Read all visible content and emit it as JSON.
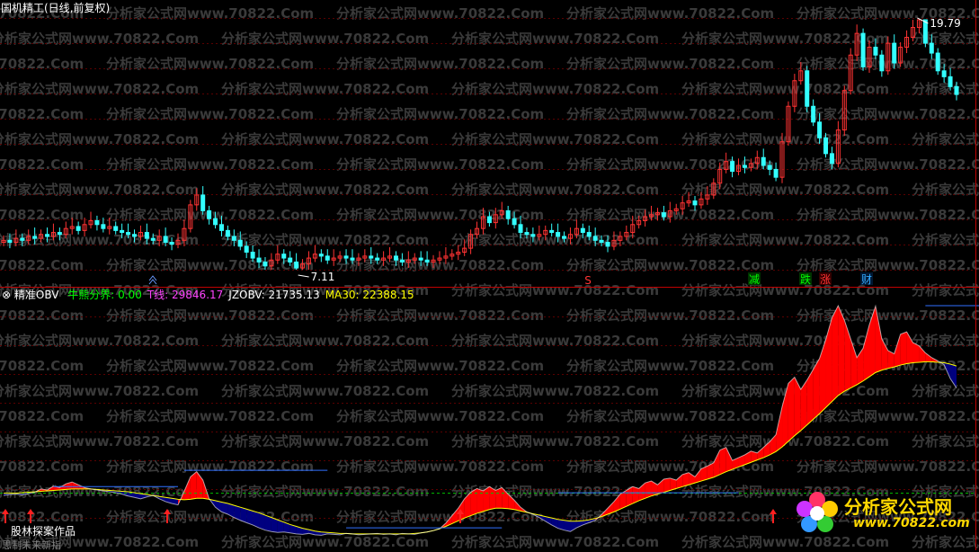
{
  "header": {
    "title": "国机精工(日线,前复权)",
    "indicator_name": "精准OBV",
    "fields": [
      {
        "label": "牛熊分界:",
        "value": "0.00",
        "color": "#00ff00"
      },
      {
        "label": "T线:",
        "value": "29846.17",
        "color": "#ff44ff"
      },
      {
        "label": "JZOBV:",
        "value": "21735.13",
        "color": "#ffffff"
      },
      {
        "label": "MA30:",
        "value": "22388.15",
        "color": "#ffff00"
      }
    ]
  },
  "watermark": {
    "cn": "分析家公式网",
    "url": "www.70822.Com"
  },
  "annotations": {
    "high_label": "19.79",
    "low_label": "7.11",
    "signals": [
      {
        "text": "减",
        "color": "#00ff00",
        "bg": "#003300"
      },
      {
        "text": "跌",
        "color": "#00ff00",
        "bg": "#003300"
      },
      {
        "text": "涨",
        "color": "#ff3333",
        "bg": "#330000"
      },
      {
        "text": "财",
        "color": "#33aaff",
        "bg": "#001833"
      }
    ],
    "s_marker": "S"
  },
  "credit": "股林探案作品",
  "credit2": "思制未来新指",
  "logo": {
    "cn": "分析家公式网",
    "url": "www.70822.com"
  },
  "colors": {
    "up": "#ff3333",
    "down": "#33ffff",
    "obv_up": "#ff0000",
    "obv_down": "#000080",
    "ma": "#ffff00",
    "tline": "#3070ff",
    "zero": "#00c000"
  },
  "chart_data": [
    {
      "type": "candlestick",
      "title": "国机精工(日线,前复权)",
      "ylim": [
        6.5,
        20.5
      ],
      "annotations": {
        "max": 19.79,
        "min": 7.11
      },
      "close": [
        8.6,
        8.5,
        8.7,
        8.6,
        8.8,
        8.7,
        8.9,
        8.8,
        9.0,
        8.9,
        9.2,
        9.3,
        9.1,
        9.4,
        9.6,
        9.4,
        9.2,
        9.3,
        9.1,
        9.0,
        8.9,
        8.8,
        9.0,
        8.7,
        8.6,
        8.8,
        8.5,
        8.4,
        8.6,
        9.2,
        10.4,
        10.9,
        10.1,
        9.7,
        9.4,
        9.1,
        8.8,
        8.6,
        8.3,
        8.0,
        7.7,
        7.5,
        7.3,
        7.6,
        7.9,
        7.7,
        7.5,
        7.2,
        7.4,
        7.7,
        7.9,
        7.8,
        7.6,
        7.7,
        7.8,
        7.7,
        7.6,
        7.7,
        7.8,
        7.7,
        7.6,
        7.7,
        7.8,
        7.6,
        7.5,
        7.6,
        7.7,
        7.6,
        7.5,
        7.6,
        7.7,
        7.8,
        7.9,
        8.0,
        8.2,
        8.9,
        9.2,
        9.8,
        9.5,
        9.9,
        10.1,
        9.7,
        9.4,
        9.0,
        8.9,
        8.8,
        8.9,
        9.1,
        9.0,
        8.8,
        8.7,
        8.9,
        9.2,
        9.0,
        8.8,
        8.6,
        8.5,
        8.3,
        8.6,
        8.8,
        9.0,
        9.4,
        9.6,
        9.8,
        9.9,
        10.0,
        9.8,
        10.1,
        10.2,
        10.5,
        10.6,
        10.4,
        10.7,
        10.9,
        11.5,
        12.2,
        12.6,
        12.1,
        12.4,
        12.3,
        12.5,
        12.8,
        12.4,
        12.2,
        11.8,
        13.6,
        15.4,
        16.7,
        17.2,
        15.4,
        14.6,
        13.8,
        13.0,
        12.5,
        14.2,
        16.2,
        18.0,
        19.1,
        17.4,
        18.4,
        18.0,
        17.2,
        18.6,
        17.6,
        18.4,
        18.9,
        19.4,
        19.79,
        18.6,
        18.1,
        17.2,
        16.9,
        16.4,
        16.0
      ]
    },
    {
      "type": "area",
      "title": "精准OBV",
      "series": [
        {
          "name": "JZOBV",
          "values": [
            -500,
            -300,
            -200,
            -400,
            -100,
            200,
            900,
            700,
            1500,
            1200,
            2000,
            2400,
            1800,
            1200,
            900,
            700,
            500,
            300,
            100,
            -200,
            -600,
            -900,
            -1200,
            -800,
            -500,
            -1200,
            -1800,
            -2200,
            -2500,
            400,
            3500,
            4600,
            2800,
            -1200,
            -3000,
            -4000,
            -4500,
            -5200,
            -5800,
            -6300,
            -6800,
            -7400,
            -7900,
            -8200,
            -8400,
            -8300,
            -8500,
            -8700,
            -8800,
            -8600,
            -8900,
            -9000,
            -8700,
            -8800,
            -8900,
            -8600,
            -8700,
            -8900,
            -8800,
            -8700,
            -8600,
            -8800,
            -8700,
            -8900,
            -8600,
            -8700,
            -8800,
            -8500,
            -8300,
            -8000,
            -7600,
            -6400,
            -4800,
            -3200,
            -1200,
            200,
            1000,
            500,
            1400,
            600,
            1200,
            -200,
            -1500,
            -3000,
            -4000,
            -4500,
            -5200,
            -6000,
            -6800,
            -7500,
            -7900,
            -8200,
            -7400,
            -6800,
            -6300,
            -5800,
            -4600,
            -3200,
            -1800,
            -200,
            600,
            1400,
            1000,
            2200,
            2600,
            1800,
            3000,
            3200,
            2800,
            4000,
            4400,
            3500,
            5200,
            5800,
            6500,
            9200,
            9800,
            7000,
            7600,
            8200,
            9000,
            8600,
            9800,
            11000,
            12500,
            18500,
            23500,
            24800,
            22200,
            24200,
            26500,
            28800,
            32800,
            37500,
            40100,
            37000,
            33000,
            29000,
            31000,
            36000,
            40000,
            33000,
            30500,
            29800,
            34000,
            34500,
            32200,
            31500,
            30000,
            29000,
            28300,
            27500,
            24500,
            22500
          ]
        },
        {
          "name": "MA30",
          "values": [
            0,
            0,
            0,
            100,
            200,
            300,
            400,
            500,
            600,
            700,
            800,
            900,
            900,
            900,
            900,
            800,
            700,
            600,
            500,
            400,
            300,
            100,
            -100,
            -300,
            -500,
            -700,
            -900,
            -1100,
            -1300,
            -1400,
            -1300,
            -1100,
            -1100,
            -1300,
            -1600,
            -1900,
            -2200,
            -2600,
            -3000,
            -3400,
            -3800,
            -4200,
            -4700,
            -5200,
            -5700,
            -6200,
            -6700,
            -7100,
            -7500,
            -7800,
            -8100,
            -8300,
            -8400,
            -8500,
            -8600,
            -8600,
            -8700,
            -8700,
            -8700,
            -8700,
            -8700,
            -8700,
            -8700,
            -8700,
            -8700,
            -8700,
            -8600,
            -8500,
            -8300,
            -8000,
            -7600,
            -7100,
            -6500,
            -5900,
            -5300,
            -4800,
            -4300,
            -3900,
            -3500,
            -3200,
            -3200,
            -3300,
            -3500,
            -3800,
            -4100,
            -4400,
            -4700,
            -5000,
            -5300,
            -5600,
            -5800,
            -6000,
            -6000,
            -5900,
            -5700,
            -5400,
            -5000,
            -4500,
            -4000,
            -3400,
            -2800,
            -2200,
            -1600,
            -1100,
            -600,
            -200,
            200,
            600,
            1000,
            1400,
            1800,
            2200,
            2600,
            3000,
            3400,
            4000,
            4600,
            5100,
            5600,
            6100,
            6600,
            7100,
            7600,
            8200,
            8900,
            9900,
            11100,
            12300,
            13400,
            14600,
            15800,
            17000,
            18300,
            19600,
            20900,
            21800,
            22500,
            23200,
            24000,
            24900,
            25800,
            26300,
            26700,
            27000,
            27400,
            27700,
            27900,
            28000,
            28100,
            28100,
            28000,
            27900,
            27600,
            27200
          ]
        }
      ],
      "t_levels": [
        1400,
        4900,
        -7400,
        100,
        40100
      ],
      "zero_line": 0
    }
  ]
}
